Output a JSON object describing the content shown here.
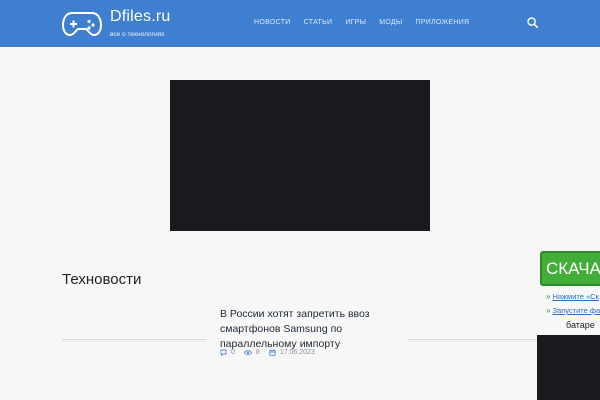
{
  "header": {
    "logo_name": "Dfiles.ru",
    "logo_tagline": "все о технологиях",
    "nav": [
      "Новости",
      "Статьи",
      "Игры",
      "Моды",
      "Приложения"
    ],
    "search_icon": "search-icon",
    "logo_icon": "gamepad-icon"
  },
  "colors": {
    "header_bg": "#3f7fcf",
    "download_green": "#43ad3a",
    "link_blue": "#2d6fb8",
    "video_bg": "#191a1d"
  },
  "section": {
    "title": "Техновости"
  },
  "news": {
    "title": "В России хотят запретить ввоз смартфонов Samsung по параллельному импорту",
    "comments": "0",
    "views": "8",
    "date": "17.06.2023"
  },
  "download_widget": {
    "button_label": "СКАЧА",
    "link_1": "Нажмите «Ск",
    "link_2": "Запустите фа",
    "text": "батаре"
  }
}
